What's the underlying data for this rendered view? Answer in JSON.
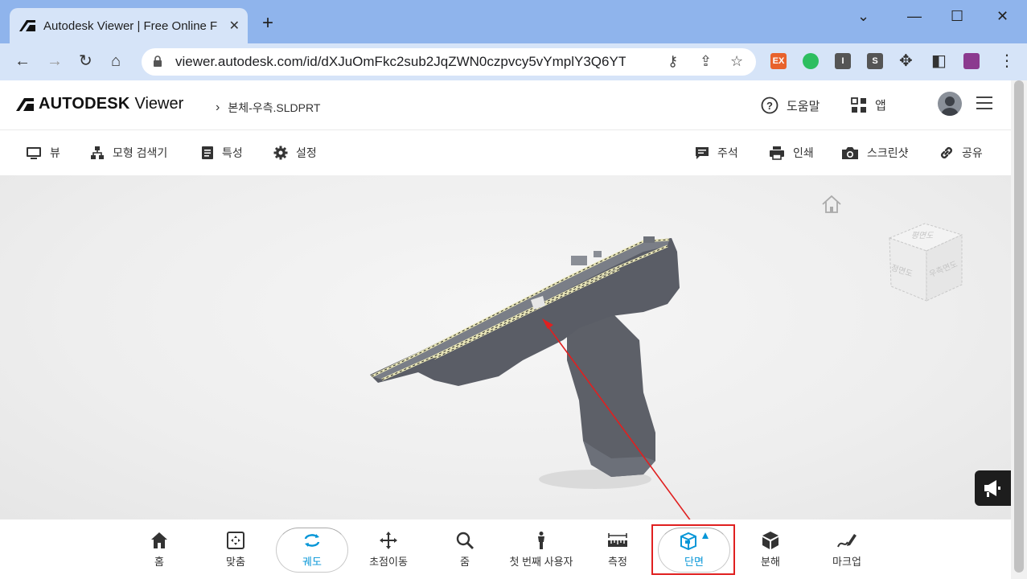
{
  "browser": {
    "tab_title": "Autodesk Viewer | Free Online F",
    "url": "viewer.autodesk.com/id/dXJuOmFkc2sub2JqZWN0czpvcy5vYmplY3Q6YT...",
    "extensions": [
      {
        "label": "EX",
        "color": "#e8622c"
      },
      {
        "label": "",
        "color": "#2dbe60"
      },
      {
        "label": "I",
        "color": "#555555"
      },
      {
        "label": "S",
        "color": "#555555"
      }
    ]
  },
  "app": {
    "brand": "AUTODESK",
    "product": "Viewer",
    "file_name": "본체-우측.SLDPRT",
    "help_label": "도움말",
    "apps_label": "앱"
  },
  "subbar": {
    "view": "뷰",
    "model_browser": "모형 검색기",
    "properties": "특성",
    "settings": "설정",
    "comments": "주석",
    "print": "인쇄",
    "screenshot": "스크린샷",
    "share": "공유"
  },
  "viewcube": {
    "top": "평면도",
    "front": "정면도",
    "right": "우측면도"
  },
  "tools": [
    {
      "label": "홈"
    },
    {
      "label": "맞춤"
    },
    {
      "label": "궤도"
    },
    {
      "label": "초점이동"
    },
    {
      "label": "줌"
    },
    {
      "label": "첫 번째 사용자"
    },
    {
      "label": "측정"
    },
    {
      "label": "단면"
    },
    {
      "label": "분해"
    },
    {
      "label": "마크업"
    }
  ],
  "colors": {
    "accent": "#0696d7",
    "annotation_red": "#e02020",
    "model_gray": "#5d6068"
  }
}
